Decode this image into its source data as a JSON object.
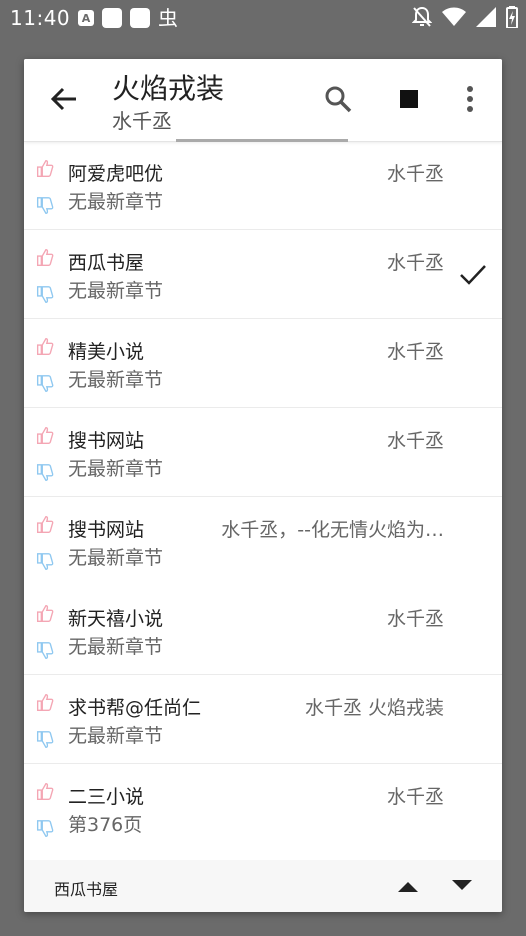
{
  "status": {
    "time": "11:40",
    "icons": [
      "text-icon",
      "square-icon",
      "square-icon",
      "bug-icon",
      "notifications-off-icon",
      "wifi-icon",
      "signal-icon",
      "battery-charging-icon"
    ]
  },
  "toolbar": {
    "title": "火焰戎装",
    "subtitle": "水千丞",
    "icons": [
      "back-arrow-icon",
      "search-icon",
      "stop-icon",
      "more-vert-icon"
    ]
  },
  "sources": [
    {
      "name": "阿爱虎吧优",
      "chapter": "无最新章节",
      "author": "水千丞",
      "selected": false
    },
    {
      "name": "西瓜书屋",
      "chapter": "无最新章节",
      "author": "水千丞",
      "selected": true
    },
    {
      "name": "精美小说",
      "chapter": "无最新章节",
      "author": "水千丞",
      "selected": false
    },
    {
      "name": "搜书网站",
      "chapter": "无最新章节",
      "author": "水千丞",
      "selected": false
    },
    {
      "name": "搜书网站",
      "chapter": "无最新章节",
      "author": "水千丞，--化无情火焰为…",
      "selected": false
    },
    {
      "name": "新天禧小说",
      "chapter": "无最新章节",
      "author": "水千丞",
      "selected": false
    },
    {
      "name": "求书帮@任尚仁",
      "chapter": "无最新章节",
      "author": "水千丞 火焰戎装",
      "selected": false
    },
    {
      "name": "二三小说",
      "chapter": "第376页",
      "author": "水千丞",
      "selected": false
    }
  ],
  "footer": {
    "current_source": "西瓜书屋"
  },
  "colors": {
    "overlay": "#6b6b6b",
    "thumb_up": "#f4a6b4",
    "thumb_down": "#8fc8f0"
  }
}
